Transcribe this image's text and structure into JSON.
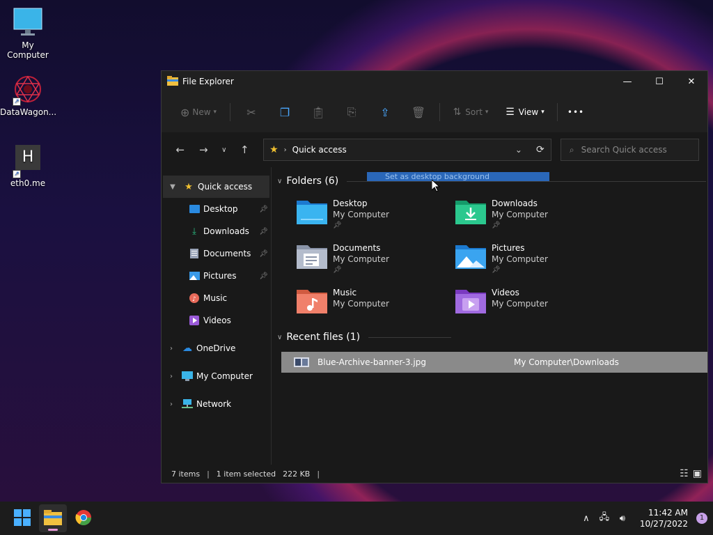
{
  "desktop": {
    "icons": [
      {
        "label": "My Computer",
        "icon": "monitor-icon"
      },
      {
        "label": "DataWagon...",
        "icon": "datawagon-logo"
      },
      {
        "label": "eth0.me",
        "icon": "h-letter-icon"
      }
    ]
  },
  "window": {
    "title": "File Explorer",
    "controls": {
      "minimize": "—",
      "maximize": "☐",
      "close": "✕"
    }
  },
  "toolbar": {
    "new_label": "New",
    "sort_label": "Sort",
    "view_label": "View",
    "more_label": "•••"
  },
  "address": {
    "path": "Quick access",
    "search_placeholder": "Search Quick access"
  },
  "sidebar": {
    "quick_access": "Quick access",
    "items": [
      {
        "label": "Desktop",
        "icon": "desktop-icon",
        "pinned": true,
        "color": "#2a8ae0"
      },
      {
        "label": "Downloads",
        "icon": "download-icon",
        "pinned": true,
        "color": "#2bbf83"
      },
      {
        "label": "Documents",
        "icon": "document-icon",
        "pinned": true,
        "color": "#9aa4b8"
      },
      {
        "label": "Pictures",
        "icon": "pictures-icon",
        "pinned": true,
        "color": "#3a9ae8"
      },
      {
        "label": "Music",
        "icon": "music-icon",
        "pinned": false,
        "color": "#e86a5a"
      },
      {
        "label": "Videos",
        "icon": "videos-icon",
        "pinned": false,
        "color": "#9a5ad8"
      }
    ],
    "onedrive": "OneDrive",
    "my_computer": "My Computer",
    "network": "Network"
  },
  "content": {
    "folders_header": "Folders (6)",
    "folders": [
      {
        "name": "Desktop",
        "location": "My Computer",
        "pinned": true
      },
      {
        "name": "Downloads",
        "location": "My Computer",
        "pinned": true
      },
      {
        "name": "Documents",
        "location": "My Computer",
        "pinned": true
      },
      {
        "name": "Pictures",
        "location": "My Computer",
        "pinned": true
      },
      {
        "name": "Music",
        "location": "My Computer",
        "pinned": false
      },
      {
        "name": "Videos",
        "location": "My Computer",
        "pinned": false
      }
    ],
    "recent_header": "Recent files (1)",
    "recent": [
      {
        "name": "Blue-Archive-banner-3.jpg",
        "path": "My Computer\\Downloads"
      }
    ],
    "tooltip": "Set as desktop background"
  },
  "status": {
    "items": "7 items",
    "selected": "1 item selected",
    "size": "222 KB"
  },
  "taskbar": {
    "time": "11:42 AM",
    "date": "10/27/2022",
    "notifications": "1"
  }
}
